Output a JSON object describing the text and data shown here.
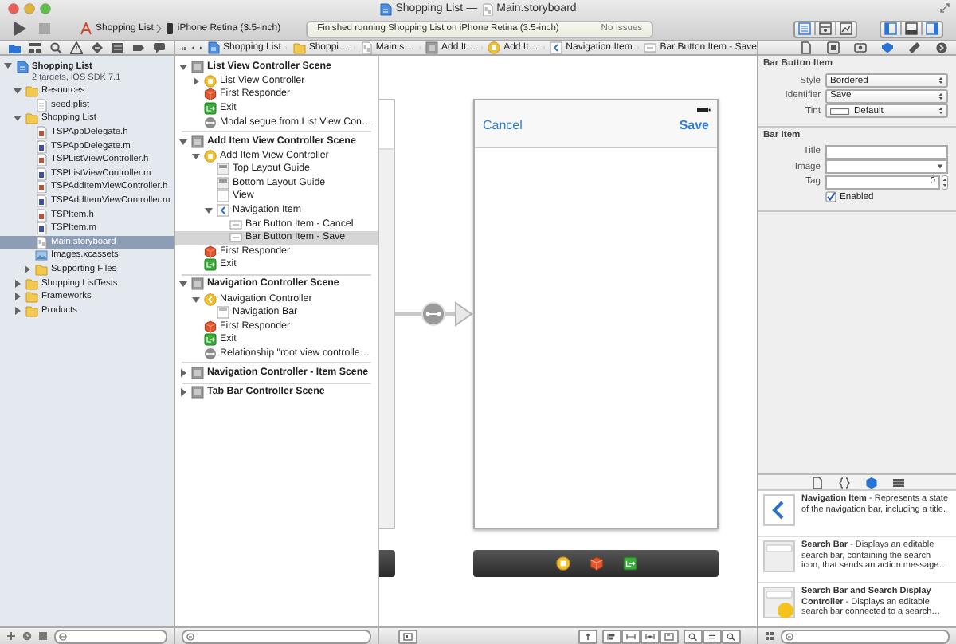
{
  "window": {
    "title_project": "Shopping List",
    "title_separator": "—",
    "title_file": "Main.storyboard"
  },
  "toolbar": {
    "scheme": "Shopping List",
    "device": "iPhone Retina (3.5-inch)",
    "status": "Finished running Shopping List on iPhone Retina (3.5-inch)",
    "issues": "No Issues",
    "editor_modes": [
      {
        "selected": true
      },
      {
        "selected": false
      },
      {
        "selected": false
      }
    ],
    "views": [
      {
        "on": true
      },
      {
        "on": false
      },
      {
        "on": true
      }
    ]
  },
  "navigator": {
    "tabs": [
      {
        "kind": "folder",
        "selected": true
      },
      {
        "kind": "hierarchy",
        "selected": false
      },
      {
        "kind": "search",
        "selected": false
      },
      {
        "kind": "warning",
        "selected": false
      },
      {
        "kind": "test",
        "selected": false
      },
      {
        "kind": "debug",
        "selected": false
      },
      {
        "kind": "breakpoint",
        "selected": false
      },
      {
        "kind": "log",
        "selected": false
      }
    ],
    "tree": [
      {
        "name": "Shopping List",
        "subtitle": "2 targets, iOS SDK 7.1",
        "kind": "project",
        "expanded": true,
        "selected": false,
        "children": [
          {
            "name": "Resources",
            "kind": "folder",
            "expanded": true,
            "selected": false,
            "children": [
              {
                "name": "seed.plist",
                "kind": "plist",
                "selected": false
              }
            ]
          },
          {
            "name": "Shopping List",
            "kind": "folder",
            "expanded": true,
            "selected": false,
            "children": [
              {
                "name": "TSPAppDelegate.h",
                "kind": "header",
                "selected": false
              },
              {
                "name": "TSPAppDelegate.m",
                "kind": "source",
                "selected": false
              },
              {
                "name": "TSPListViewController.h",
                "kind": "header",
                "selected": false
              },
              {
                "name": "TSPListViewController.m",
                "kind": "source",
                "selected": false
              },
              {
                "name": "TSPAddItemViewController.h",
                "kind": "header",
                "selected": false
              },
              {
                "name": "TSPAddItemViewController.m",
                "kind": "source",
                "selected": false
              },
              {
                "name": "TSPItem.h",
                "kind": "header",
                "selected": false
              },
              {
                "name": "TSPItem.m",
                "kind": "source",
                "selected": false
              },
              {
                "name": "Main.storyboard",
                "kind": "storyboard",
                "selected": true
              },
              {
                "name": "Images.xcassets",
                "kind": "assets",
                "selected": false
              },
              {
                "name": "Supporting Files",
                "kind": "folder",
                "expanded": false,
                "selected": false
              }
            ]
          },
          {
            "name": "Shopping ListTests",
            "kind": "folder",
            "expanded": false,
            "selected": false
          },
          {
            "name": "Frameworks",
            "kind": "folder",
            "expanded": false,
            "selected": false
          },
          {
            "name": "Products",
            "kind": "folder",
            "expanded": false,
            "selected": false
          }
        ]
      }
    ]
  },
  "jump_bar": [
    {
      "kind": "project",
      "label": "Shopping List"
    },
    {
      "kind": "folder",
      "label": "Shoppi…"
    },
    {
      "kind": "storyboard",
      "label": "Main.s…"
    },
    {
      "kind": "scene",
      "label": "Add It…"
    },
    {
      "kind": "controller",
      "label": "Add It…"
    },
    {
      "kind": "navitem",
      "label": "Navigation Item"
    },
    {
      "kind": "baritem",
      "label": "Bar Button Item - Save"
    }
  ],
  "outline": [
    {
      "name": "List View Controller Scene",
      "kind": "scene",
      "expanded": true,
      "selected": false,
      "children": [
        {
          "name": "List View Controller",
          "kind": "controller",
          "expanded": false,
          "selected": false
        },
        {
          "name": "First Responder",
          "kind": "responder",
          "selected": false
        },
        {
          "name": "Exit",
          "kind": "exit",
          "selected": false
        },
        {
          "name": "Modal segue from List View Con…",
          "kind": "segue",
          "selected": false
        }
      ]
    },
    {
      "name": "Add Item View Controller Scene",
      "kind": "scene",
      "expanded": true,
      "selected": false,
      "children": [
        {
          "name": "Add Item View Controller",
          "kind": "controller",
          "expanded": true,
          "selected": false,
          "children": [
            {
              "name": "Top Layout Guide",
              "kind": "guide",
              "selected": false
            },
            {
              "name": "Bottom Layout Guide",
              "kind": "guide",
              "selected": false
            },
            {
              "name": "View",
              "kind": "view",
              "selected": false
            },
            {
              "name": "Navigation Item",
              "kind": "navitem",
              "expanded": true,
              "selected": false,
              "children": [
                {
                  "name": "Bar Button Item - Cancel",
                  "kind": "baritem",
                  "selected": false
                },
                {
                  "name": "Bar Button Item - Save",
                  "kind": "baritem",
                  "selected": true
                }
              ]
            }
          ]
        },
        {
          "name": "First Responder",
          "kind": "responder",
          "selected": false
        },
        {
          "name": "Exit",
          "kind": "exit",
          "selected": false
        }
      ]
    },
    {
      "name": "Navigation Controller Scene",
      "kind": "scene",
      "expanded": true,
      "selected": false,
      "children": [
        {
          "name": "Navigation Controller",
          "kind": "navcontroller",
          "expanded": true,
          "selected": false,
          "children": [
            {
              "name": "Navigation Bar",
              "kind": "navbar",
              "selected": false
            }
          ]
        },
        {
          "name": "First Responder",
          "kind": "responder",
          "selected": false
        },
        {
          "name": "Exit",
          "kind": "exit",
          "selected": false
        },
        {
          "name": "Relationship \"root view controlle…",
          "kind": "segue",
          "selected": false
        }
      ]
    },
    {
      "name": "Navigation Controller - Item Scene",
      "kind": "scene",
      "expanded": false,
      "selected": false
    },
    {
      "name": "Tab Bar Controller Scene",
      "kind": "scene",
      "expanded": false,
      "selected": false
    }
  ],
  "canvas": {
    "left_button": "Cancel",
    "right_button": "Save",
    "dock": [
      {
        "kind": "controller"
      },
      {
        "kind": "responder"
      },
      {
        "kind": "exit"
      }
    ]
  },
  "inspector": {
    "tabs": [
      {
        "kind": "file",
        "selected": false
      },
      {
        "kind": "help",
        "selected": false
      },
      {
        "kind": "identity",
        "selected": false
      },
      {
        "kind": "attributes",
        "selected": true
      },
      {
        "kind": "size",
        "selected": false
      },
      {
        "kind": "connections",
        "selected": false
      }
    ],
    "sections": [
      {
        "title": "Bar Button Item",
        "fields": [
          {
            "label": "Style",
            "kind": "popup",
            "value": "Bordered"
          },
          {
            "label": "Identifier",
            "kind": "popup",
            "value": "Save"
          },
          {
            "label": "Tint",
            "kind": "color",
            "value": "Default"
          }
        ]
      },
      {
        "title": "Bar Item",
        "fields": [
          {
            "label": "Title",
            "kind": "text"
          },
          {
            "label": "Image",
            "kind": "combo"
          },
          {
            "label": "Tag",
            "kind": "stepper",
            "value": "0"
          },
          {
            "label": "Enabled",
            "kind": "checkbox",
            "checked": true
          }
        ]
      }
    ]
  },
  "library": {
    "tabs": [
      {
        "kind": "file",
        "selected": false
      },
      {
        "kind": "code",
        "selected": false
      },
      {
        "kind": "object",
        "selected": true
      },
      {
        "kind": "media",
        "selected": false
      }
    ],
    "items": [
      {
        "kind": "navitem",
        "text": "**Navigation Item** - Represents a state of the navigation bar, including a title."
      },
      {
        "kind": "searchbar",
        "text": "**Search Bar** - Displays an editable search bar, containing the search icon, that sends an action message…"
      },
      {
        "kind": "searchdisplay",
        "text": "**Search Bar and Search Display Controller** - Displays an editable search bar connected to a search…"
      }
    ]
  }
}
